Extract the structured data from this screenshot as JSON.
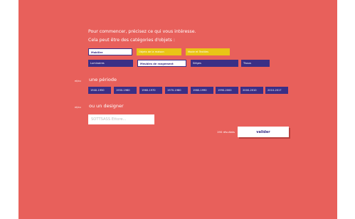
{
  "intro": {
    "line1": "Pour commencer, précisez ce qui vous intéresse.",
    "line2": "Cela peut être des catégories d'objets :"
  },
  "categories": {
    "row1": [
      "Mobilier",
      "Objets de la maison",
      "Mode et Textiles"
    ],
    "row2": [
      "Luminaires",
      "Meubles de rangement",
      "Sièges",
      "Tissus"
    ]
  },
  "period": {
    "or_label": "et/ou",
    "title": "une période",
    "ranges": [
      "1940-1950",
      "1950-1960",
      "1960-1970",
      "1970-1980",
      "1980-1990",
      "1990-2000",
      "2000-2010",
      "2010-2017"
    ]
  },
  "designer": {
    "or_label": "et/ou",
    "title": "ou un designer",
    "placeholder": "SOTTSASS Ettore..."
  },
  "footer": {
    "results": "190 résultats",
    "validate_label": "valider"
  },
  "colors": {
    "background": "#e8605b",
    "navy": "#3a2f86",
    "yellow": "#e9c516"
  }
}
